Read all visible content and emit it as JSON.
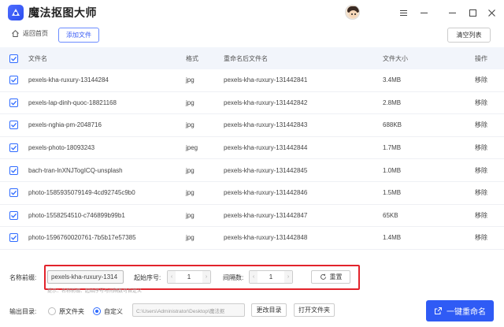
{
  "app": {
    "title": "魔法抠图大师"
  },
  "window": {
    "menu_icon": "hamburger-menu-icon",
    "minimize_icon": "minimize-icon",
    "maximize_icon": "maximize-icon",
    "close_icon": "close-icon"
  },
  "toolbar": {
    "back_label": "返回首页",
    "add_label": "添加文件",
    "clear_label": "清空列表"
  },
  "table": {
    "headers": {
      "name": "文件名",
      "format": "格式",
      "new_name": "重命名后文件名",
      "size": "文件大小",
      "op": "操作"
    },
    "rows": [
      {
        "name": "pexels-kha-ruxury-13144284",
        "format": "jpg",
        "new_name": "pexels-kha-ruxury-131442841",
        "size": "3.4MB",
        "op": "移除",
        "checked": true
      },
      {
        "name": "pexels-lap-dinh-quoc-18821168",
        "format": "jpg",
        "new_name": "pexels-kha-ruxury-131442842",
        "size": "2.8MB",
        "op": "移除",
        "checked": true
      },
      {
        "name": "pexels-nghia-pm-2048716",
        "format": "jpg",
        "new_name": "pexels-kha-ruxury-131442843",
        "size": "688KB",
        "op": "移除",
        "checked": true
      },
      {
        "name": "pexels-photo-18093243",
        "format": "jpeg",
        "new_name": "pexels-kha-ruxury-131442844",
        "size": "1.7MB",
        "op": "移除",
        "checked": true
      },
      {
        "name": "bach-tran-lnXNJTogICQ-unsplash",
        "format": "jpg",
        "new_name": "pexels-kha-ruxury-131442845",
        "size": "1.0MB",
        "op": "移除",
        "checked": true
      },
      {
        "name": "photo-1585935079149-4cd92745c9b0",
        "format": "jpg",
        "new_name": "pexels-kha-ruxury-131442846",
        "size": "1.5MB",
        "op": "移除",
        "checked": true
      },
      {
        "name": "photo-1558254510-c746899b99b1",
        "format": "jpg",
        "new_name": "pexels-kha-ruxury-131442847",
        "size": "65KB",
        "op": "移除",
        "checked": true
      },
      {
        "name": "photo-1596760020761-7b5b17e57385",
        "format": "jpg",
        "new_name": "pexels-kha-ruxury-131442848",
        "size": "1.4MB",
        "op": "移除",
        "checked": true
      }
    ]
  },
  "settings": {
    "prefix_label": "名称前缀:",
    "prefix_value": "pexels-kha-ruxury-1314",
    "start_label": "起始序号:",
    "start_value": "1",
    "interval_label": "间隔数:",
    "interval_value": "1",
    "reset_label": "重置",
    "hint": "提示：名称前缀、起始序号与间隔数可自定义"
  },
  "output": {
    "label": "输出目录:",
    "option_original": "原文件夹",
    "option_custom": "自定义",
    "selected": "custom",
    "path_value": "C:\\Users\\Administrator\\Desktop\\魔法抠",
    "change_label": "更改目录",
    "open_label": "打开文件夹"
  },
  "action": {
    "rename_label": "一键重命名"
  },
  "colors": {
    "accent": "#2f5bf5",
    "highlight_box": "#e2232b",
    "header_bg": "#f2f5fb"
  }
}
